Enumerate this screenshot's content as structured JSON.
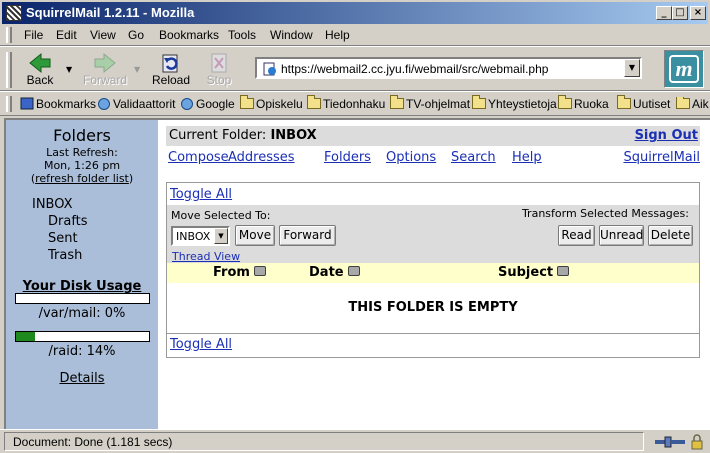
{
  "window": {
    "title": "SquirrelMail 1.2.11 - Mozilla"
  },
  "menu": [
    {
      "label": "File"
    },
    {
      "label": "Edit"
    },
    {
      "label": "View"
    },
    {
      "label": "Go"
    },
    {
      "label": "Bookmarks"
    },
    {
      "label": "Tools"
    },
    {
      "label": "Window"
    },
    {
      "label": "Help"
    }
  ],
  "nav": {
    "back": "Back",
    "forward": "Forward",
    "reload": "Reload",
    "stop": "Stop",
    "url": "https://webmail2.cc.jyu.fi/webmail/src/webmail.php"
  },
  "bookmarks": [
    "Bookmarks",
    "Validaattorit",
    "Google",
    "Opiskelu",
    "Tiedonhaku",
    "TV-ohjelmat",
    "Yhteystietoja",
    "Ruoka",
    "Uutiset",
    "Aik"
  ],
  "sidebar": {
    "title": "Folders",
    "last_refresh": "Last Refresh:",
    "refresh_time": "Mon, 1:26 pm",
    "refresh_open": "(",
    "refresh_link": "refresh folder list",
    "refresh_close": ")",
    "folders": [
      "INBOX",
      "Drafts",
      "Sent",
      "Trash"
    ],
    "disk_title": "Your Disk Usage",
    "quota": [
      {
        "label": "/var/mail: 0%",
        "percent": 0
      },
      {
        "label": "/raid: 14%",
        "percent": 14
      }
    ],
    "details": "Details"
  },
  "main": {
    "current_folder_label": "Current Folder:",
    "current_folder": "INBOX",
    "sign_out": "Sign Out",
    "links": [
      "Compose",
      "Addresses",
      "Folders",
      "Options",
      "Search",
      "Help"
    ],
    "brand_link": "SquirrelMail",
    "toggle_all": "Toggle All",
    "move_label": "Move Selected To:",
    "transform_label": "Transform Selected Messages:",
    "move_select": "INBOX",
    "buttons": {
      "move": "Move",
      "forward": "Forward",
      "read": "Read",
      "unread": "Unread",
      "delete": "Delete"
    },
    "thread_view": "Thread View",
    "columns": [
      "From",
      "Date",
      "Subject"
    ],
    "empty": "THIS FOLDER IS EMPTY"
  },
  "status": {
    "text": "Document: Done (1.181 secs)"
  }
}
